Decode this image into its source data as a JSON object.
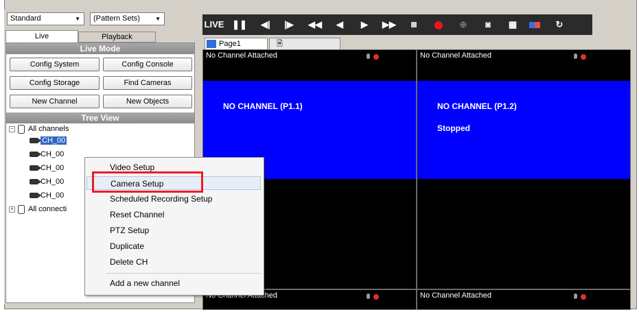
{
  "left": {
    "view_select": "Standard",
    "pattern_select": "(Pattern Sets)",
    "tabs": [
      "Live",
      "Playback"
    ],
    "live_mode_header": "Live Mode",
    "buttons": {
      "config_system": "Config System",
      "config_console": "Config Console",
      "config_storage": "Config Storage",
      "find_cameras": "Find Cameras",
      "new_channel": "New Channel",
      "new_objects": "New Objects"
    },
    "tree_header": "Tree View",
    "tree": {
      "root": "All channels",
      "channels": [
        "CH_00",
        "CH_00",
        "CH_00",
        "CH_00",
        "CH_00"
      ],
      "connections": "All connecti"
    }
  },
  "toolbar": {
    "live_label": "LIVE",
    "icons": [
      "pause-icon",
      "step-back-icon",
      "step-forward-icon",
      "fast-rewind-icon",
      "play-reverse-icon",
      "play-icon",
      "fast-forward-icon",
      "stop-icon",
      "record-icon",
      "zoom-icon",
      "snapshot-icon",
      "layout-icon",
      "color-icon",
      "refresh-icon"
    ]
  },
  "page_tab": "Page1",
  "cells": [
    {
      "title": "No Channel Attached",
      "label": "NO CHANNEL (P1.1)",
      "status": ""
    },
    {
      "title": "No Channel Attached",
      "label": "NO CHANNEL (P1.2)",
      "status": "Stopped"
    },
    {
      "title": "No Channel Attached"
    },
    {
      "title": "No Channel Attached"
    }
  ],
  "context_menu": {
    "items": [
      "Video Setup",
      "Camera Setup",
      "Scheduled Recording Setup",
      "Reset Channel",
      "PTZ Setup",
      "Duplicate",
      "Delete CH",
      "Add a new channel"
    ],
    "highlighted": "Camera Setup"
  },
  "colors": {
    "video_bg": "#0000ff",
    "highlight_box": "#ee1c24",
    "record": "#e8161c"
  }
}
